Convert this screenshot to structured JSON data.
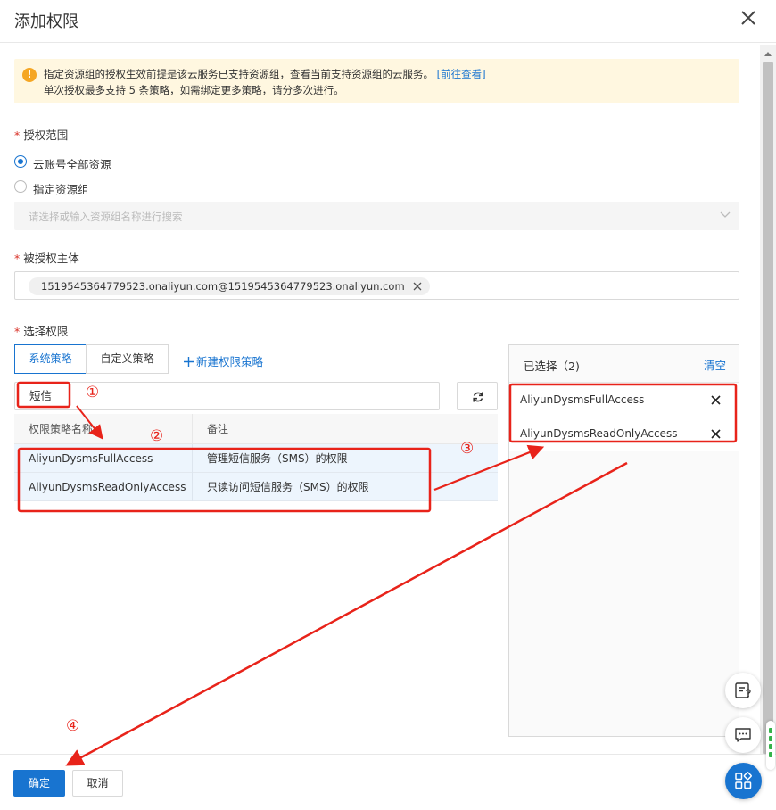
{
  "dialog": {
    "title": "添加权限"
  },
  "alert": {
    "line1": "指定资源组的授权生效前提是该云服务已支持资源组，查看当前支持资源组的云服务。",
    "link": "[前往查看]",
    "line2": "单次授权最多支持 5 条策略，如需绑定更多策略，请分多次进行。"
  },
  "scope": {
    "label": "授权范围",
    "options": [
      "云账号全部资源",
      "指定资源组"
    ],
    "selected_index": 0,
    "resource_group_placeholder": "请选择或输入资源组名称进行搜索"
  },
  "principal": {
    "label": "被授权主体",
    "tag": "1519545364779523.onaliyun.com@1519545364779523.onaliyun.com"
  },
  "permissions": {
    "label": "选择权限",
    "tabs": [
      "系统策略",
      "自定义策略"
    ],
    "active_tab": 0,
    "new_policy": "新建权限策略",
    "search_value": "短信",
    "columns": [
      "权限策略名称",
      "备注"
    ],
    "rows": [
      {
        "name": "AliyunDysmsFullAccess",
        "note": "管理短信服务（SMS）的权限"
      },
      {
        "name": "AliyunDysmsReadOnlyAccess",
        "note": "只读访问短信服务（SMS）的权限"
      }
    ]
  },
  "selected": {
    "title": "已选择（2)",
    "clear": "清空",
    "items": [
      "AliyunDysmsFullAccess",
      "AliyunDysmsReadOnlyAccess"
    ]
  },
  "footer": {
    "ok": "确定",
    "cancel": "取消"
  },
  "annotations": [
    "①",
    "②",
    "③",
    "④"
  ],
  "colors": {
    "primary": "#1874d0",
    "annotation": "#e8231a",
    "alert_bg": "#fff7e0",
    "row_selected_bg": "#edf5fd"
  },
  "icons": [
    "warning-icon",
    "close-icon",
    "refresh-icon",
    "plus-icon",
    "chevron-down-icon",
    "feedback-icon",
    "chat-icon",
    "apps-icon"
  ]
}
